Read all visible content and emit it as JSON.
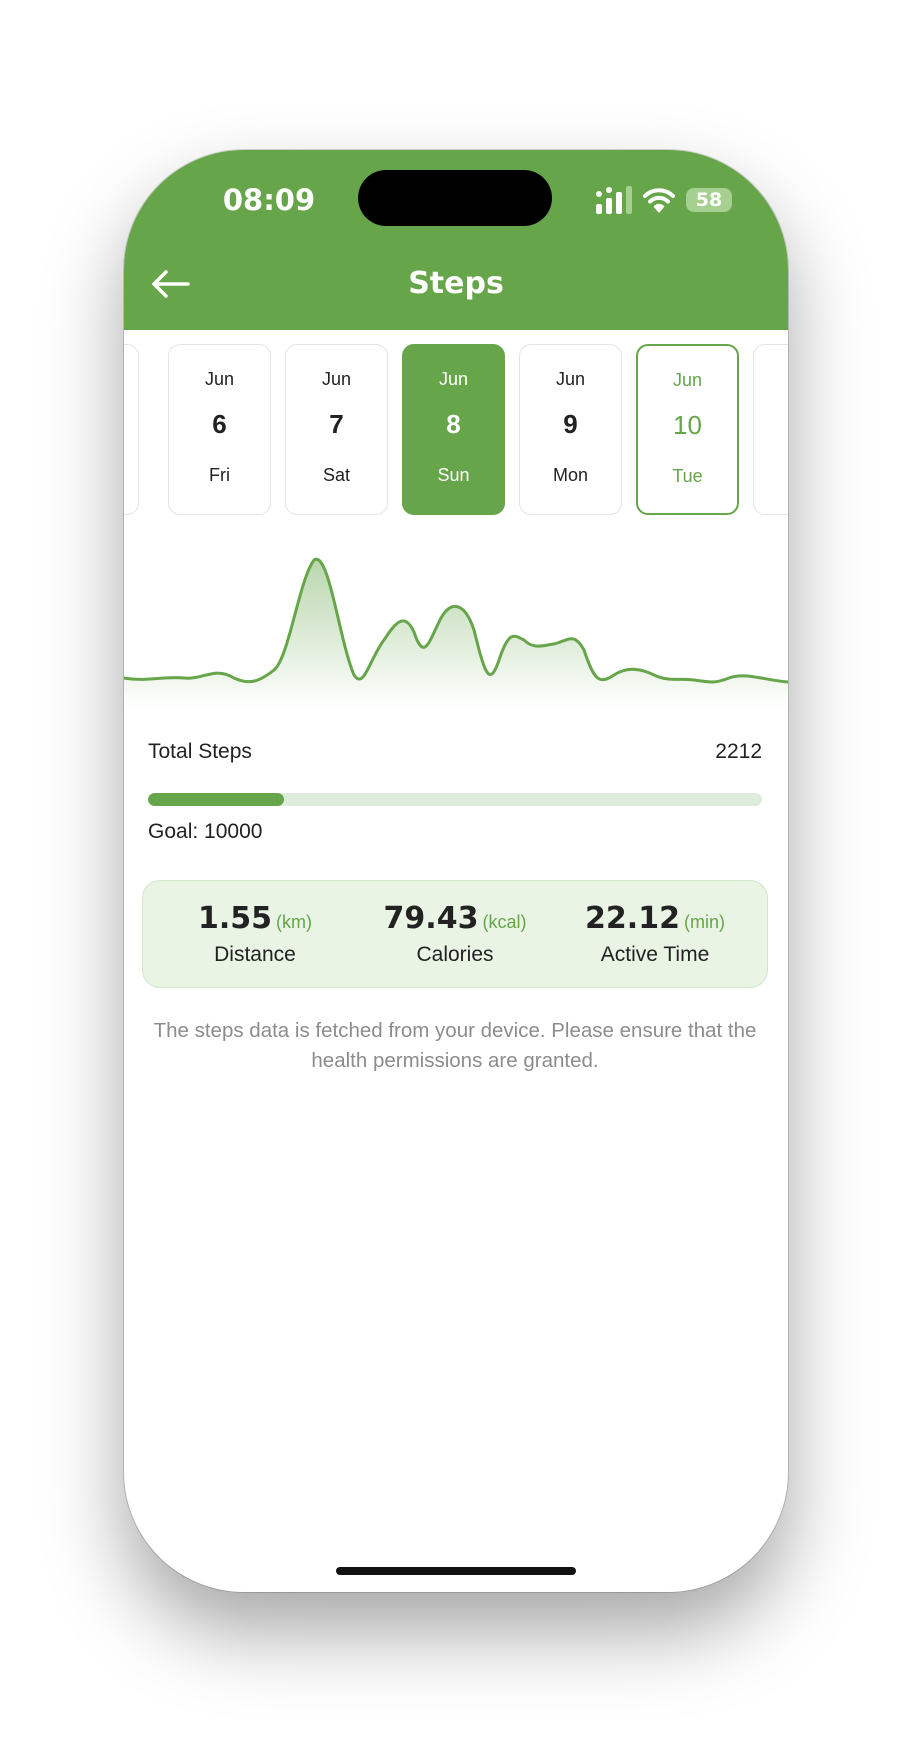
{
  "status_bar": {
    "time": "08:09",
    "battery": "58"
  },
  "header": {
    "title": "Steps"
  },
  "dates": [
    {
      "month": "",
      "day": "",
      "weekday": "",
      "state": "partial"
    },
    {
      "month": "Jun",
      "day": "6",
      "weekday": "Fri",
      "state": "normal"
    },
    {
      "month": "Jun",
      "day": "7",
      "weekday": "Sat",
      "state": "normal"
    },
    {
      "month": "Jun",
      "day": "8",
      "weekday": "Sun",
      "state": "selected"
    },
    {
      "month": "Jun",
      "day": "9",
      "weekday": "Mon",
      "state": "normal"
    },
    {
      "month": "Jun",
      "day": "10",
      "weekday": "Tue",
      "state": "today"
    },
    {
      "month": "",
      "day": "",
      "weekday": "",
      "state": "partial"
    }
  ],
  "steps": {
    "label": "Total Steps",
    "value": "2212",
    "goal_label": "Goal: 10000",
    "progress": 0.2212
  },
  "stats": [
    {
      "value": "1.55",
      "unit": "(km)",
      "label": "Distance"
    },
    {
      "value": "79.43",
      "unit": "(kcal)",
      "label": "Calories"
    },
    {
      "value": "22.12",
      "unit": "(min)",
      "label": "Active Time"
    }
  ],
  "note": "The steps data is fetched from your device. Please ensure that the health permissions are granted.",
  "colors": {
    "accent": "#66a54a",
    "accent_light": "#e9f4e4",
    "track": "#deeddb"
  }
}
